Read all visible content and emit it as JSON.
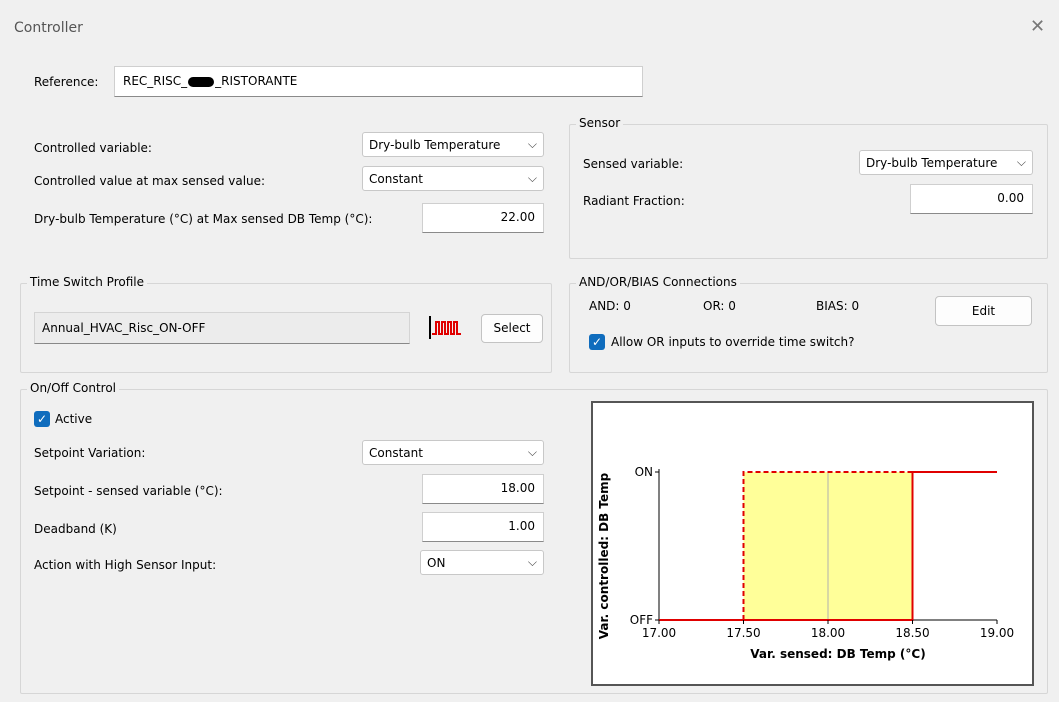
{
  "window": {
    "title": "Controller",
    "close_glyph": "✕"
  },
  "reference": {
    "label": "Reference:",
    "value_prefix": "REC_RISC_",
    "value_suffix": "_RISTORANTE"
  },
  "controlled": {
    "var_label": "Controlled variable:",
    "var_value": "Dry-bulb Temperature",
    "max_label": "Controlled value at max sensed value:",
    "max_value": "Constant",
    "db_label": "Dry-bulb Temperature (°C) at Max sensed DB Temp (°C):",
    "db_value": "22.00"
  },
  "sensor": {
    "title": "Sensor",
    "sensed_label": "Sensed variable:",
    "sensed_value": "Dry-bulb Temperature",
    "radiant_label": "Radiant Fraction:",
    "radiant_value": "0.00"
  },
  "time_switch": {
    "title": "Time Switch Profile",
    "profile": "Annual_HVAC_Risc_ON-OFF",
    "select_label": "Select"
  },
  "connections": {
    "title": "AND/OR/BIAS Connections",
    "and": "AND: 0",
    "or": "OR: 0",
    "bias": "BIAS: 0",
    "edit_label": "Edit",
    "override_label": "Allow OR inputs to override time switch?",
    "override_checked": true
  },
  "onoff": {
    "title": "On/Off Control",
    "active_label": "Active",
    "active_checked": true,
    "setpoint_var_label": "Setpoint Variation:",
    "setpoint_var_value": "Constant",
    "setpoint_label": "Setpoint - sensed variable (°C):",
    "setpoint_value": "18.00",
    "deadband_label": "Deadband (K)",
    "deadband_value": "1.00",
    "action_label": "Action with High Sensor Input:",
    "action_value": "ON"
  },
  "chart_data": {
    "type": "line",
    "xlabel": "Var. sensed: DB Temp (°C)",
    "ylabel": "Var. controlled: DB Temp",
    "xlim": [
      17.0,
      19.0
    ],
    "x_ticks": [
      "17.00",
      "17.50",
      "18.00",
      "18.50",
      "19.00"
    ],
    "y_ticks": [
      "OFF",
      "ON"
    ],
    "on_threshold": 18.5,
    "off_threshold": 17.5,
    "setpoint": 18.0,
    "band_color": "#ffff99",
    "line_color": "#e00000",
    "series": [
      {
        "x": [
          17.0,
          18.5,
          18.5,
          19.0
        ],
        "y": [
          "OFF",
          "OFF",
          "ON",
          "ON"
        ]
      },
      {
        "x": [
          17.5,
          17.5,
          18.5
        ],
        "y": [
          "OFF",
          "ON",
          "ON"
        ]
      }
    ]
  }
}
